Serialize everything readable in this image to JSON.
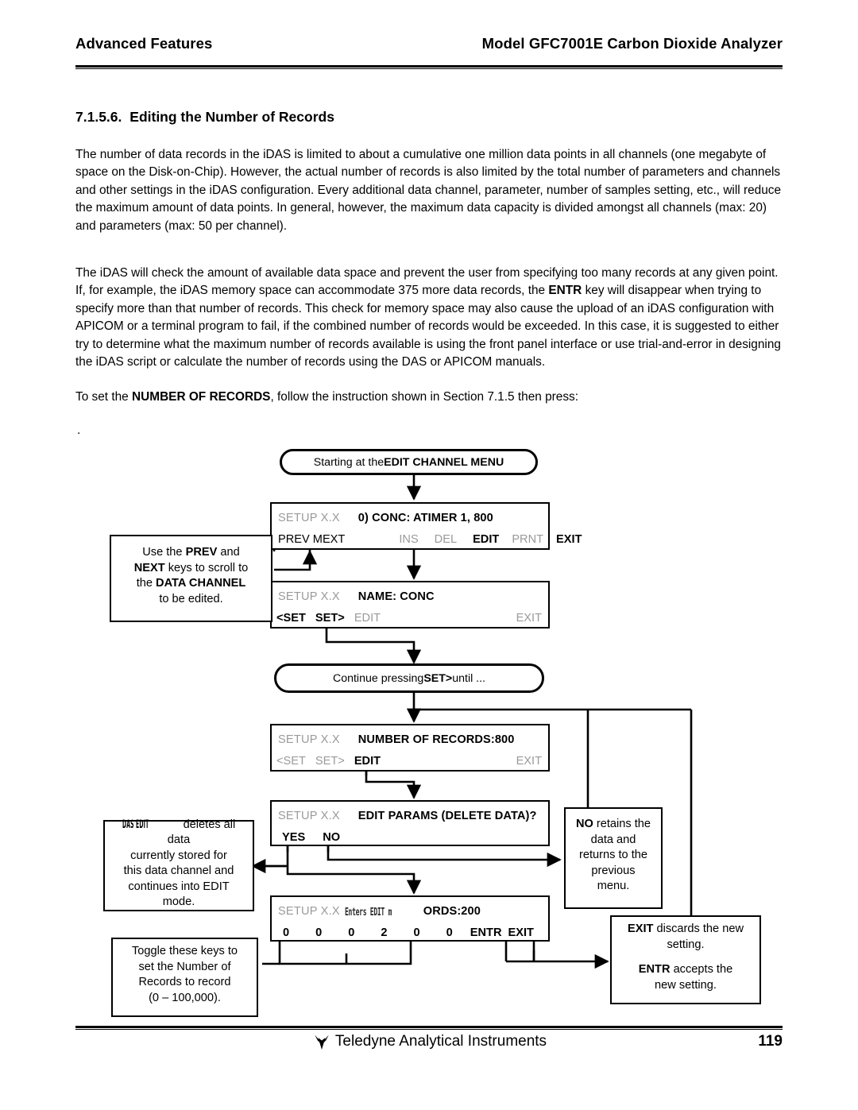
{
  "header": {
    "left": "Advanced Features",
    "right": "Model GFC7001E Carbon Dioxide Analyzer"
  },
  "section": {
    "number": "7.1.5.6.",
    "title": "Editing the Number of Records"
  },
  "paragraphs": {
    "p1": "The number of data records in the iDAS is limited to about a cumulative one million data points in all channels (one megabyte of space on the Disk-on-Chip).  However, the actual number of records is also limited by the total number of parameters and channels and other settings in the iDAS configuration.  Every additional data channel, parameter, number of samples setting, etc.,  will reduce the maximum amount of data points.  In general, however, the maximum data capacity is divided amongst all channels (max: 20) and parameters (max: 50 per channel).",
    "p2_a": "The iDAS will check the amount of available data space and prevent the user from specifying too many records at any given point.  If, for example, the iDAS memory space can accommodate 375 more data records, the ",
    "p2_b": "ENTR",
    "p2_c": " key will disappear when trying to specify more than that number of records.  This check for memory space may also cause the upload of an iDAS configuration with APICOM or a terminal program to fail, if the combined number of records would be exceeded.  In this case, it is suggested to either try to determine what the maximum number of records available is using the front panel interface or use trial-and-error in designing the iDAS script or calculate the number of records using the DAS or APICOM manuals.",
    "p3_a": "To set the ",
    "p3_b": "NUMBER OF RECORDS",
    "p3_c": ", follow the instruction shown in Section 7.1.5 then press:",
    "stray_dot": "."
  },
  "flow": {
    "start": {
      "pre": "Starting at the ",
      "bold": "EDIT CHANNEL MENU"
    },
    "continue": {
      "a": "Continue pressing ",
      "b": "SET>",
      "c": " until ..."
    },
    "screens": [
      {
        "name": "conc-channel-screen",
        "setup": "SETUP X.X",
        "title": "0) CONC:  ATIMER 1, 800",
        "keys_left": "PREV MEXT",
        "keys": [
          {
            "label": "INS",
            "state": "dim"
          },
          {
            "label": "DEL",
            "state": "dim"
          },
          {
            "label": "EDIT",
            "state": "on"
          },
          {
            "label": "PRNT",
            "state": "dim"
          },
          {
            "label": "EXIT",
            "state": "on"
          }
        ]
      },
      {
        "name": "name-conc-screen",
        "setup": "SETUP X.X",
        "title": "NAME: CONC",
        "keys": [
          {
            "label": "<SET",
            "state": "on"
          },
          {
            "label": "SET>",
            "state": "on"
          },
          {
            "label": "EDIT",
            "state": "dim"
          },
          {
            "label": "EXIT",
            "state": "dim"
          }
        ]
      },
      {
        "name": "number-of-records-screen",
        "setup": "SETUP X.X",
        "title": "NUMBER OF RECORDS:800",
        "keys": [
          {
            "label": "<SET",
            "state": "dim"
          },
          {
            "label": "SET>",
            "state": "dim"
          },
          {
            "label": "EDIT",
            "state": "on"
          },
          {
            "label": "EXIT",
            "state": "dim"
          }
        ]
      },
      {
        "name": "edit-params-screen",
        "setup": "SETUP X.X",
        "title": "EDIT PARAMS (DELETE DATA)?",
        "keys": [
          {
            "label": "YES",
            "state": "on"
          },
          {
            "label": "NO",
            "state": "on"
          }
        ]
      },
      {
        "name": "records-digit-entry-screen",
        "setup": "SETUP X.X",
        "title": "ORDS:200",
        "artifact": "Enters EDIT m",
        "digits": [
          "0",
          "0",
          "0",
          "2",
          "0",
          "0"
        ],
        "keys": [
          {
            "label": "ENTR",
            "state": "on"
          },
          {
            "label": "EXIT",
            "state": "on"
          }
        ]
      }
    ],
    "notes": [
      {
        "name": "prev-next-note",
        "lines": [
          [
            {
              "t": "Use the ",
              "b": false
            },
            {
              "t": "PREV",
              "b": true
            },
            {
              "t": " and",
              "b": false
            }
          ],
          [
            {
              "t": "NEXT",
              "b": true
            },
            {
              "t": " keys to scroll to",
              "b": false
            }
          ],
          [
            {
              "t": "the ",
              "b": false
            },
            {
              "t": "DATA CHANNEL",
              "b": true
            }
          ],
          [
            {
              "t": "to be edited.",
              "b": false
            }
          ]
        ]
      },
      {
        "name": "das-edit-note",
        "lead": "DAS EDIT",
        "lines": [
          [
            {
              "t": " deletes all data",
              "b": false
            }
          ],
          [
            {
              "t": "currently stored for",
              "b": false
            }
          ],
          [
            {
              "t": "this data channel and",
              "b": false
            }
          ],
          [
            {
              "t": "continues into EDIT",
              "b": false
            }
          ],
          [
            {
              "t": "mode.",
              "b": false
            }
          ]
        ]
      },
      {
        "name": "toggle-keys-note",
        "lines": [
          [
            {
              "t": "Toggle these keys to",
              "b": false
            }
          ],
          [
            {
              "t": "set the Number of",
              "b": false
            }
          ],
          [
            {
              "t": "Records to record",
              "b": false
            }
          ],
          [
            {
              "t": "(0 – 100,000).",
              "b": false
            }
          ]
        ]
      },
      {
        "name": "no-retains-note",
        "lines": [
          [
            {
              "t": "NO",
              "b": true
            },
            {
              "t": " retains the",
              "b": false
            }
          ],
          [
            {
              "t": "data and",
              "b": false
            }
          ],
          [
            {
              "t": "returns to the",
              "b": false
            }
          ],
          [
            {
              "t": "previous",
              "b": false
            }
          ],
          [
            {
              "t": "menu.",
              "b": false
            }
          ]
        ]
      },
      {
        "name": "exit-entr-note",
        "lines": [
          [
            {
              "t": "EXIT",
              "b": true
            },
            {
              "t": " discards the new",
              "b": false
            }
          ],
          [
            {
              "t": "setting.",
              "b": false
            }
          ],
          [
            {
              "t": "",
              "b": false
            }
          ],
          [
            {
              "t": "ENTR",
              "b": true
            },
            {
              "t": " accepts the",
              "b": false
            }
          ],
          [
            {
              "t": "new setting.",
              "b": false
            }
          ]
        ]
      }
    ]
  },
  "footer": {
    "company": "Teledyne Analytical Instruments",
    "page": "119"
  }
}
